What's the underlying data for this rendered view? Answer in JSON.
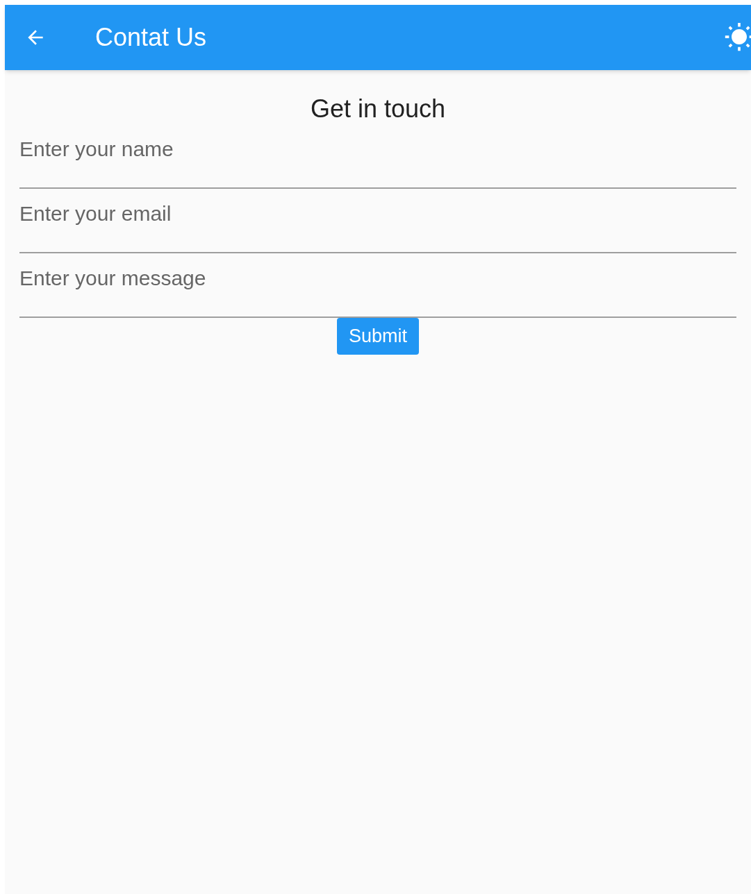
{
  "app_bar": {
    "title": "Contat Us"
  },
  "heading": "Get in touch",
  "fields": [
    {
      "placeholder": "Enter your name"
    },
    {
      "placeholder": "Enter your email"
    },
    {
      "placeholder": "Enter your message"
    }
  ],
  "submit_button": "Submit"
}
